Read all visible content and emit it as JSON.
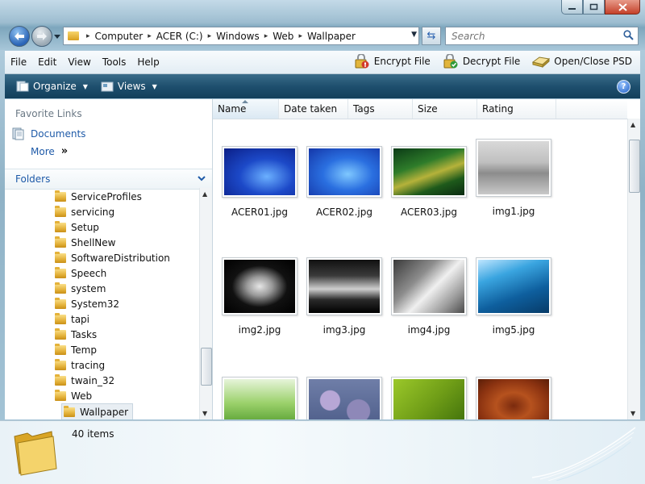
{
  "window": {
    "breadcrumb": [
      "Computer",
      "ACER (C:)",
      "Windows",
      "Web",
      "Wallpaper"
    ],
    "search_placeholder": "Search"
  },
  "menubar": {
    "items": [
      "File",
      "Edit",
      "View",
      "Tools",
      "Help"
    ],
    "tools": [
      {
        "label": "Encrypt File",
        "icon": "encrypt-lock-icon"
      },
      {
        "label": "Decrypt File",
        "icon": "decrypt-lock-icon"
      },
      {
        "label": "Open/Close PSD",
        "icon": "psd-drive-icon"
      }
    ]
  },
  "commandbar": {
    "organize": "Organize",
    "views": "Views"
  },
  "nav": {
    "favorite_links_title": "Favorite Links",
    "documents": "Documents",
    "more": "More",
    "folders_title": "Folders",
    "tree": [
      "ServiceProfiles",
      "servicing",
      "Setup",
      "ShellNew",
      "SoftwareDistribution",
      "Speech",
      "system",
      "System32",
      "tapi",
      "Tasks",
      "Temp",
      "tracing",
      "twain_32",
      "Web",
      "Wallpaper"
    ],
    "selected": "Wallpaper"
  },
  "columns": [
    "Name",
    "Date taken",
    "Tags",
    "Size",
    "Rating"
  ],
  "files": [
    {
      "name": "ACER01.jpg",
      "thumb": "acer1"
    },
    {
      "name": "ACER02.jpg",
      "thumb": "acer2"
    },
    {
      "name": "ACER03.jpg",
      "thumb": "acer3"
    },
    {
      "name": "img1.jpg",
      "thumb": "img1"
    },
    {
      "name": "img2.jpg",
      "thumb": "img2"
    },
    {
      "name": "img3.jpg",
      "thumb": "img3"
    },
    {
      "name": "img4.jpg",
      "thumb": "img4"
    },
    {
      "name": "img5.jpg",
      "thumb": "img5"
    },
    {
      "name": "",
      "thumb": "img6"
    },
    {
      "name": "",
      "thumb": "img7"
    },
    {
      "name": "",
      "thumb": "img8"
    },
    {
      "name": "",
      "thumb": "img9"
    }
  ],
  "details": {
    "items_count": "40 items"
  }
}
